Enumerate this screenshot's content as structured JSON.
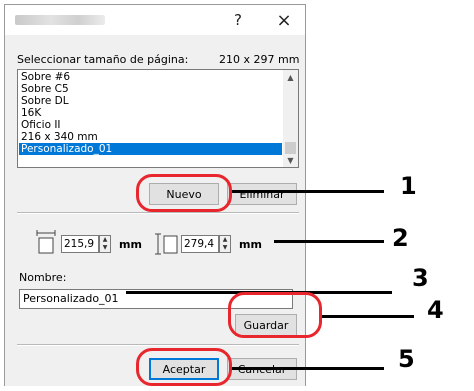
{
  "dialog": {
    "title_bar": {
      "help_glyph": "?",
      "close_glyph": "×"
    },
    "page_size_label": "Seleccionar tamaño de página:",
    "page_size_value": "210 x 297 mm",
    "list_items": [
      "Sobre #6",
      "Sobre C5",
      "Sobre DL",
      "16K",
      "Oficio II",
      "216 x 340 mm",
      "Personalizado_01"
    ],
    "selected_index": 6,
    "buttons": {
      "nuevo": "Nuevo",
      "eliminar": "Eliminar",
      "guardar": "Guardar",
      "aceptar": "Aceptar",
      "cancelar": "Cancelar"
    },
    "width_value": "215,9",
    "height_value": "279,4",
    "unit_width": "mm",
    "unit_height": "mm",
    "name_label": "Nombre:",
    "name_value": "Personalizado_01"
  },
  "callouts": [
    "1",
    "2",
    "3",
    "4",
    "5"
  ],
  "icons": {
    "help": "help-icon",
    "close": "close-icon",
    "scroll_up": "chevron-up-icon",
    "scroll_down": "chevron-down-icon",
    "width": "width-dimension-icon",
    "height": "height-dimension-icon"
  },
  "colors": {
    "selection": "#0078d7",
    "callout": "#e8262d"
  }
}
